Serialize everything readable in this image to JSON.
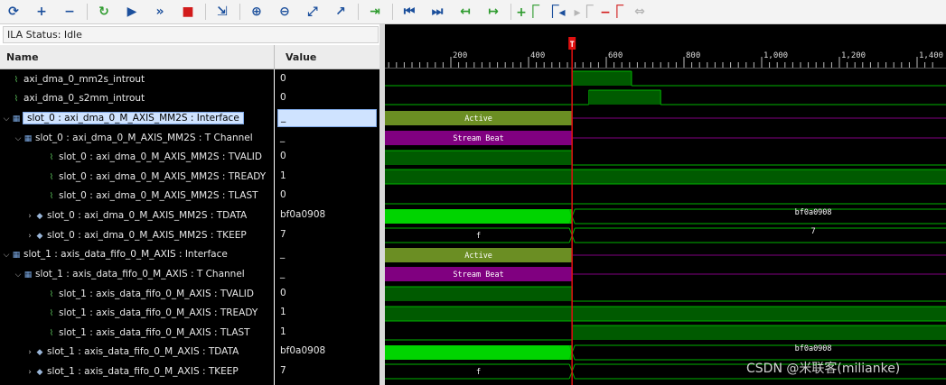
{
  "toolbar": {
    "buttons": [
      {
        "name": "refresh-icon",
        "glyph": "⟳"
      },
      {
        "name": "add-icon",
        "glyph": "+"
      },
      {
        "name": "remove-icon",
        "glyph": "−"
      },
      {
        "name": "run-trigger-immediate-icon",
        "glyph": "↻"
      },
      {
        "name": "run-trigger-icon",
        "glyph": "▶"
      },
      {
        "name": "run-continuous-icon",
        "glyph": "»"
      },
      {
        "name": "stop-icon",
        "glyph": "■"
      },
      {
        "name": "export-icon",
        "glyph": "⇲"
      },
      {
        "name": "zoom-in-icon",
        "glyph": "⊕"
      },
      {
        "name": "zoom-out-icon",
        "glyph": "⊖"
      },
      {
        "name": "zoom-fit-icon",
        "glyph": "⤢"
      },
      {
        "name": "cursor-icon",
        "glyph": "↗"
      },
      {
        "name": "go-to-cursor-icon",
        "glyph": "⇥"
      },
      {
        "name": "go-to-start-icon",
        "glyph": "⏮"
      },
      {
        "name": "go-to-end-icon",
        "glyph": "⏭"
      },
      {
        "name": "previous-transition-icon",
        "glyph": "↤"
      },
      {
        "name": "next-transition-icon",
        "glyph": "↦"
      },
      {
        "name": "add-marker-icon",
        "glyph": "+⎾"
      },
      {
        "name": "previous-marker-icon",
        "glyph": "⎾◂"
      },
      {
        "name": "next-marker-icon",
        "glyph": "▸⎾"
      },
      {
        "name": "delete-marker-icon",
        "glyph": "−⎾"
      },
      {
        "name": "swap-icon",
        "glyph": "⇔"
      }
    ]
  },
  "status": {
    "text": "ILA Status: Idle"
  },
  "columns": {
    "name": "Name",
    "value": "Value"
  },
  "rows": [
    {
      "name": "axi_dma_0_mm2s_introut",
      "value": "0",
      "icon": "bit",
      "indent": 0,
      "expander": ""
    },
    {
      "name": "axi_dma_0_s2mm_introut",
      "value": "0",
      "icon": "bit",
      "indent": 0,
      "expander": ""
    },
    {
      "name": "slot_0 : axi_dma_0_M_AXIS_MM2S : Interface",
      "value": "_",
      "icon": "itf",
      "indent": 0,
      "expander": "⌵",
      "selected": true
    },
    {
      "name": "slot_0 : axi_dma_0_M_AXIS_MM2S : T Channel",
      "value": "_",
      "icon": "itf",
      "indent": 1,
      "expander": "⌵"
    },
    {
      "name": "slot_0 : axi_dma_0_M_AXIS_MM2S : TVALID",
      "value": "0",
      "icon": "bit",
      "indent": 3,
      "expander": ""
    },
    {
      "name": "slot_0 : axi_dma_0_M_AXIS_MM2S : TREADY",
      "value": "1",
      "icon": "bit",
      "indent": 3,
      "expander": ""
    },
    {
      "name": "slot_0 : axi_dma_0_M_AXIS_MM2S : TLAST",
      "value": "0",
      "icon": "bit",
      "indent": 3,
      "expander": ""
    },
    {
      "name": "slot_0 : axi_dma_0_M_AXIS_MM2S : TDATA",
      "value": "bf0a0908",
      "icon": "bus",
      "indent": 2,
      "expander": "›"
    },
    {
      "name": "slot_0 : axi_dma_0_M_AXIS_MM2S : TKEEP",
      "value": "7",
      "icon": "bus",
      "indent": 2,
      "expander": "›"
    },
    {
      "name": "slot_1 : axis_data_fifo_0_M_AXIS : Interface",
      "value": "_",
      "icon": "itf",
      "indent": 0,
      "expander": "⌵"
    },
    {
      "name": "slot_1 : axis_data_fifo_0_M_AXIS : T Channel",
      "value": "_",
      "icon": "itf",
      "indent": 1,
      "expander": "⌵"
    },
    {
      "name": "slot_1 : axis_data_fifo_0_M_AXIS : TVALID",
      "value": "0",
      "icon": "bit",
      "indent": 3,
      "expander": ""
    },
    {
      "name": "slot_1 : axis_data_fifo_0_M_AXIS : TREADY",
      "value": "1",
      "icon": "bit",
      "indent": 3,
      "expander": ""
    },
    {
      "name": "slot_1 : axis_data_fifo_0_M_AXIS : TLAST",
      "value": "1",
      "icon": "bit",
      "indent": 3,
      "expander": ""
    },
    {
      "name": "slot_1 : axis_data_fifo_0_M_AXIS : TDATA",
      "value": "bf0a0908",
      "icon": "bus",
      "indent": 2,
      "expander": "›"
    },
    {
      "name": "slot_1 : axis_data_fifo_0_M_AXIS : TKEEP",
      "value": "7",
      "icon": "bus",
      "indent": 2,
      "expander": "›"
    }
  ],
  "waveform": {
    "axis_ticks": [
      "200",
      "400",
      "600",
      "800",
      "1,000",
      "1,200",
      "1,400"
    ],
    "trigger_marker": "T",
    "trigger_sample": 512,
    "labels": {
      "active": "Active",
      "stream_beat": "Stream Beat",
      "slot0_tdata_after": "bf0a0908",
      "slot0_tkeep_before": "f",
      "slot0_tkeep_after": "7",
      "slot1_tdata_after": "bf0a0908",
      "slot1_tkeep_before": "f"
    },
    "colors": {
      "signal": "#00b400",
      "bus_fill": "#00d400",
      "active_fill": "#6b8e23",
      "stream_beat_fill": "#800080",
      "trigger": "#e01010"
    }
  },
  "watermark": "CSDN @米联客(milianke)"
}
